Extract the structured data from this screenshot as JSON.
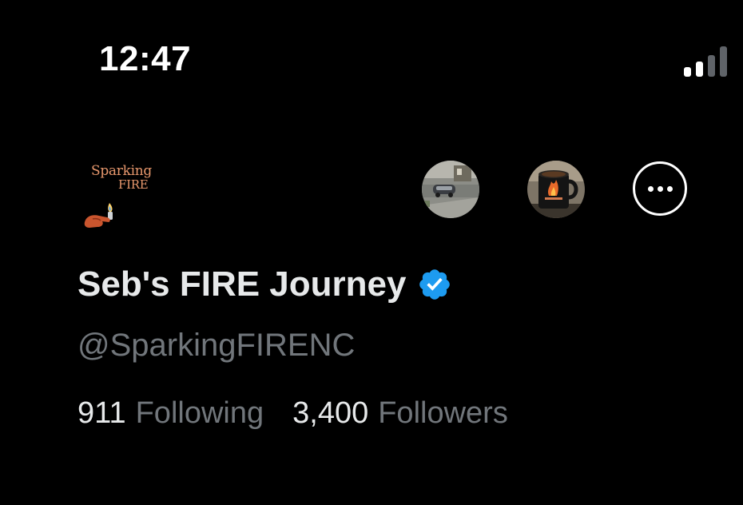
{
  "status_bar": {
    "time": "12:47",
    "signal_icon": "cellular-signal-icon"
  },
  "profile": {
    "logo_text_line1": "Sparking",
    "logo_text_line2": "FIRE",
    "display_name": "Seb's FIRE Journey",
    "verified_icon": "verified-badge-icon",
    "handle": "@SparkingFIRENC",
    "following_count": "911",
    "following_label": "Following",
    "followers_count": "3,400",
    "followers_label": "Followers"
  },
  "actions": {
    "more_icon": "more-options-icon"
  },
  "colors": {
    "background": "#000000",
    "primary_text": "#e7e9ea",
    "secondary_text": "#71767b",
    "verified_blue": "#1d9bf0",
    "logo_orange": "#e8986d"
  }
}
